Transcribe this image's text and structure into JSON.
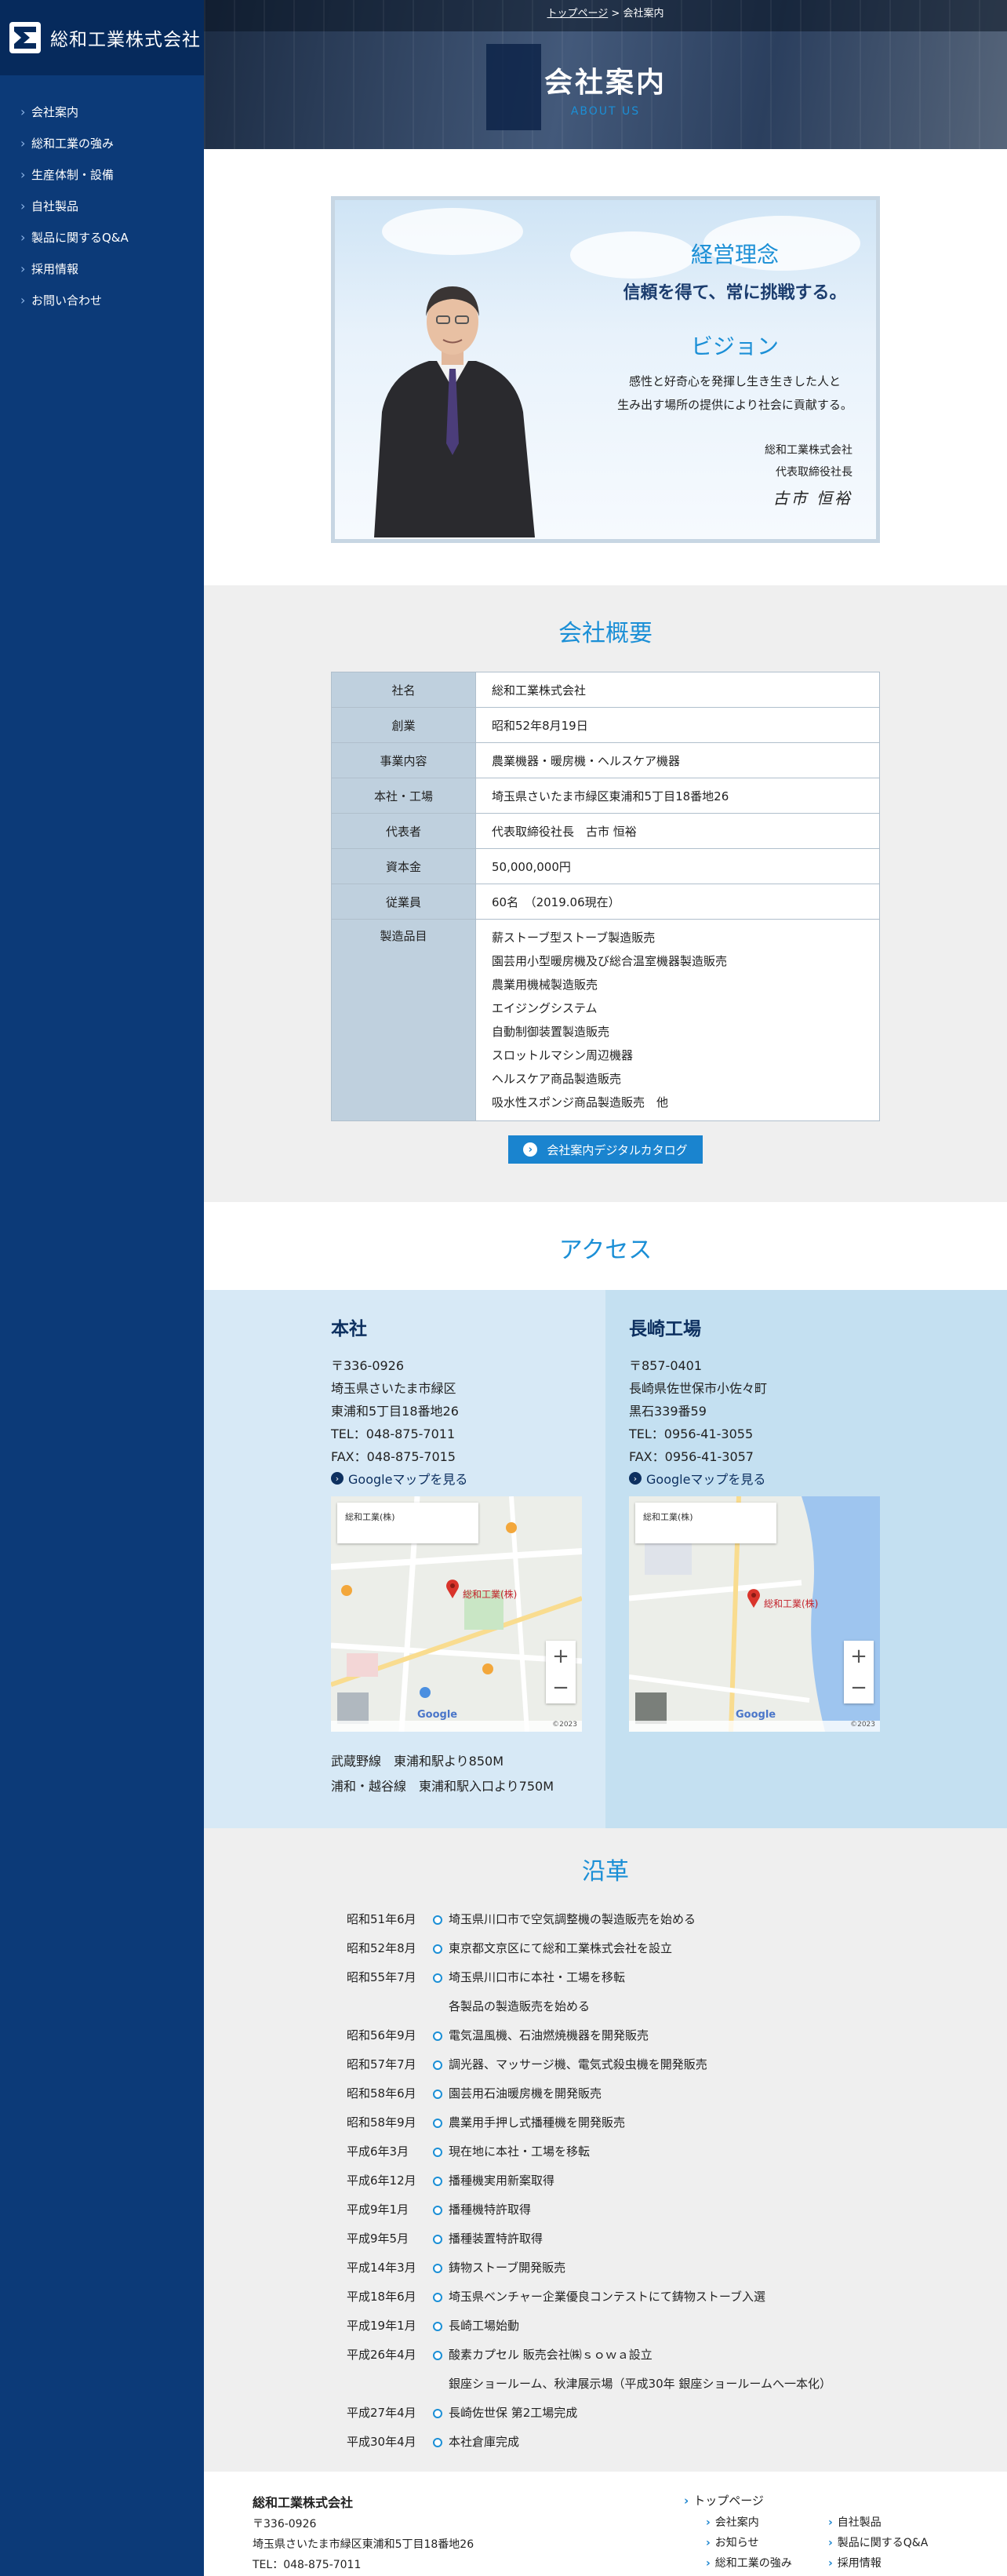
{
  "site": {
    "logo_text": "総和工業株式会社"
  },
  "nav": [
    "会社案内",
    "総和工業の強み",
    "生産体制・設備",
    "自社製品",
    "製品に関するQ&A",
    "採用情報",
    "お問い合わせ"
  ],
  "breadcrumb": {
    "home": "トップページ",
    "sep": ">",
    "current": "会社案内"
  },
  "hero": {
    "title": "会社案内",
    "subtitle": "ABOUT US"
  },
  "message": {
    "philosophy_title": "経営理念",
    "philosophy": "信頼を得て、常に挑戦する。",
    "vision_title": "ビジョン",
    "vision_line1": "感性と好奇心を発揮し生き生きした人と",
    "vision_line2": "生み出す場所の提供により社会に貢献する。",
    "company": "総和工業株式会社",
    "position": "代表取締役社長",
    "signature": "古市 恒裕"
  },
  "overview": {
    "heading": "会社概要",
    "rows": [
      {
        "k": "社名",
        "v": "総和工業株式会社"
      },
      {
        "k": "創業",
        "v": "昭和52年8月19日"
      },
      {
        "k": "事業内容",
        "v": "農業機器・暖房機・ヘルスケア機器"
      },
      {
        "k": "本社・工場",
        "v": "埼玉県さいたま市緑区東浦和5丁目18番地26"
      },
      {
        "k": "代表者",
        "v": "代表取締役社長　古市 恒裕"
      },
      {
        "k": "資本金",
        "v": "50,000,000円"
      },
      {
        "k": "従業員",
        "v": "60名　（2019.06現在）"
      }
    ],
    "products_label": "製造品目",
    "products": [
      "薪ストーブ型ストーブ製造販売",
      "園芸用小型暖房機及び総合温室機器製造販売",
      "農業用機械製造販売",
      "エイジングシステム",
      "自動制御装置製造販売",
      "スロットルマシン周辺機器",
      "ヘルスケア商品製造販売",
      "吸水性スポンジ商品製造販売　他"
    ],
    "catalog_button": "会社案内デジタルカタログ"
  },
  "access": {
    "heading": "アクセス",
    "honsha": {
      "title": "本社",
      "lines": [
        "〒336-0926",
        "埼玉県さいたま市緑区",
        "東浦和5丁目18番地26",
        "TEL：048-875-7011",
        "FAX：048-875-7015"
      ],
      "map_link": "Googleマップを見る",
      "map_box": "総和工業(株)",
      "map_label": "総和工業(株)",
      "map_year": "©2023",
      "station1": "武蔵野線　東浦和駅より850M",
      "station2": "浦和・越谷線　東浦和駅入口より750M"
    },
    "nagasaki": {
      "title": "長崎工場",
      "lines": [
        "〒857-0401",
        "長崎県佐世保市小佐々町",
        "黒石339番59",
        "TEL：0956-41-3055",
        "FAX：0956-41-3057"
      ],
      "map_link": "Googleマップを見る",
      "map_box": "総和工業(株)",
      "map_label": "総和工業(株)",
      "map_year": "©2023"
    }
  },
  "history": {
    "heading": "沿革",
    "items": [
      {
        "d": "昭和51年6月",
        "e": "埼玉県川口市で空気調整機の製造販売を始める"
      },
      {
        "d": "昭和52年8月",
        "e": "東京都文京区にて総和工業株式会社を設立"
      },
      {
        "d": "昭和55年7月",
        "e": "埼玉県川口市に本社・工場を移転",
        "e2": "各製品の製造販売を始める"
      },
      {
        "d": "昭和56年9月",
        "e": "電気温風機、石油燃焼機器を開発販売"
      },
      {
        "d": "昭和57年7月",
        "e": "調光器、マッサージ機、電気式殺虫機を開発販売"
      },
      {
        "d": "昭和58年6月",
        "e": "園芸用石油暖房機を開発販売"
      },
      {
        "d": "昭和58年9月",
        "e": "農業用手押し式播種機を開発販売"
      },
      {
        "d": "平成6年3月",
        "e": "現在地に本社・工場を移転"
      },
      {
        "d": "平成6年12月",
        "e": "播種機実用新案取得"
      },
      {
        "d": "平成9年1月",
        "e": "播種機特許取得"
      },
      {
        "d": "平成9年5月",
        "e": "播種装置特許取得"
      },
      {
        "d": "平成14年3月",
        "e": "鋳物ストーブ開発販売"
      },
      {
        "d": "平成18年6月",
        "e": "埼玉県ベンチャー企業優良コンテストにて鋳物ストーブ入選"
      },
      {
        "d": "平成19年1月",
        "e": "長崎工場始動"
      },
      {
        "d": "平成26年4月",
        "e": "酸素カプセル 販売会社㈱ｓｏｗａ設立",
        "e2": "銀座ショールーム、秋津展示場（平成30年 銀座ショールームへ一本化）"
      },
      {
        "d": "平成27年4月",
        "e": "長崎佐世保 第2工場完成"
      },
      {
        "d": "平成30年4月",
        "e": "本社倉庫完成"
      }
    ]
  },
  "footer": {
    "name": "総和工業株式会社",
    "lines": [
      "〒336-0926",
      "埼玉県さいたま市緑区東浦和5丁目18番地26",
      "TEL：048-875-7011"
    ],
    "top_link": "トップページ",
    "links_a": [
      "会社案内",
      "お知らせ",
      "総和工業の強み"
    ],
    "links_b": [
      "自社製品",
      "製品に関するQ&A",
      "採用情報"
    ]
  }
}
